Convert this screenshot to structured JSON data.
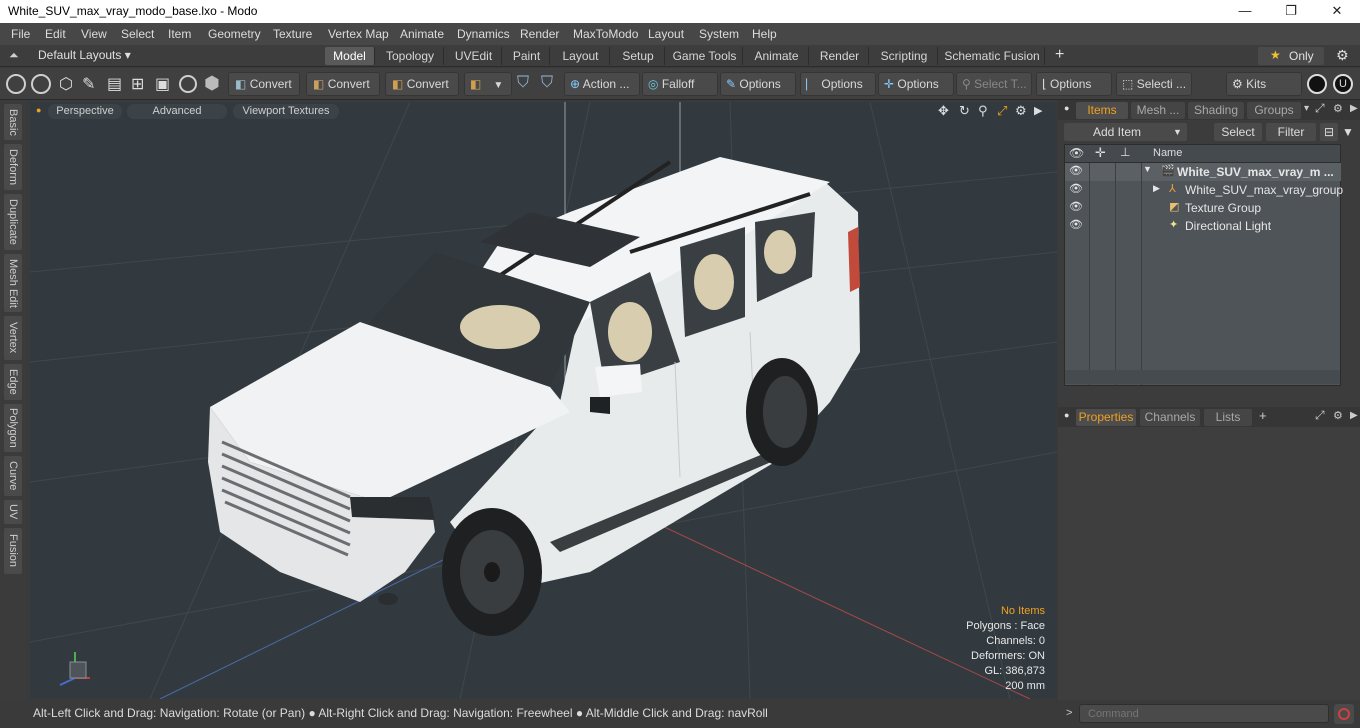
{
  "window": {
    "title": "White_SUV_max_vray_modo_base.lxo - Modo",
    "minimize": "—",
    "maximize": "❐",
    "close": "✕"
  },
  "menu": [
    "File",
    "Edit",
    "View",
    "Select",
    "Item",
    "Geometry",
    "Texture",
    "Vertex Map",
    "Animate",
    "Dynamics",
    "Render",
    "MaxToModo",
    "Layout",
    "System",
    "Help"
  ],
  "layouts": {
    "default_label": "Default Layouts ▾",
    "tabs": [
      "Model",
      "Topology",
      "UVEdit",
      "Paint",
      "Layout",
      "Setup",
      "Game Tools",
      "Animate",
      "Render",
      "Scripting",
      "Schematic Fusion"
    ],
    "active": "Model",
    "add": "+",
    "only_label": "Only",
    "star": "★"
  },
  "toolbar": {
    "convert1": "Convert",
    "convert2": "Convert",
    "convert3": "Convert",
    "action": "Action ...",
    "falloff": "Falloff",
    "options1": "Options",
    "options2": "Options",
    "options3": "Options",
    "select_t": "Select T...",
    "options4": "Options",
    "selecti": "Selecti ...",
    "kits": "Kits"
  },
  "left_tabs": [
    "Basic",
    "Deform",
    "Duplicate",
    "Mesh Edit",
    "Vertex",
    "Edge",
    "Polygon",
    "Curve",
    "UV",
    "Fusion"
  ],
  "viewport": {
    "perspective": "Perspective",
    "advanced": "Advanced",
    "viewport_textures": "Viewport Textures",
    "info": {
      "no_items": "No Items",
      "polygons": "Polygons : Face",
      "channels": "Channels: 0",
      "deformers": "Deformers: ON",
      "gl": "GL: 386,873",
      "scale": "200 mm"
    }
  },
  "status": "Alt-Left Click and Drag: Navigation: Rotate (or Pan) ● Alt-Right Click and Drag: Navigation: Freewheel ● Alt-Middle Click and Drag: navRoll",
  "items_panel": {
    "tabs": [
      "Items",
      "Mesh ...",
      "Shading",
      "Groups"
    ],
    "add_item": "Add Item",
    "select": "Select",
    "filter": "Filter",
    "name_header": "Name",
    "rows": [
      {
        "label": "White_SUV_max_vray_m ...",
        "bold": true
      },
      {
        "label": "White_SUV_max_vray_group"
      },
      {
        "label": "Texture Group"
      },
      {
        "label": "Directional Light"
      }
    ]
  },
  "properties_panel": {
    "tabs": [
      "Properties",
      "Channels",
      "Lists"
    ],
    "add": "+"
  },
  "command": {
    "placeholder": "Command"
  },
  "colors": {
    "accent": "#f0a020",
    "viewport_bg": "#323a3f",
    "panel_bg": "#3c3c3c"
  }
}
